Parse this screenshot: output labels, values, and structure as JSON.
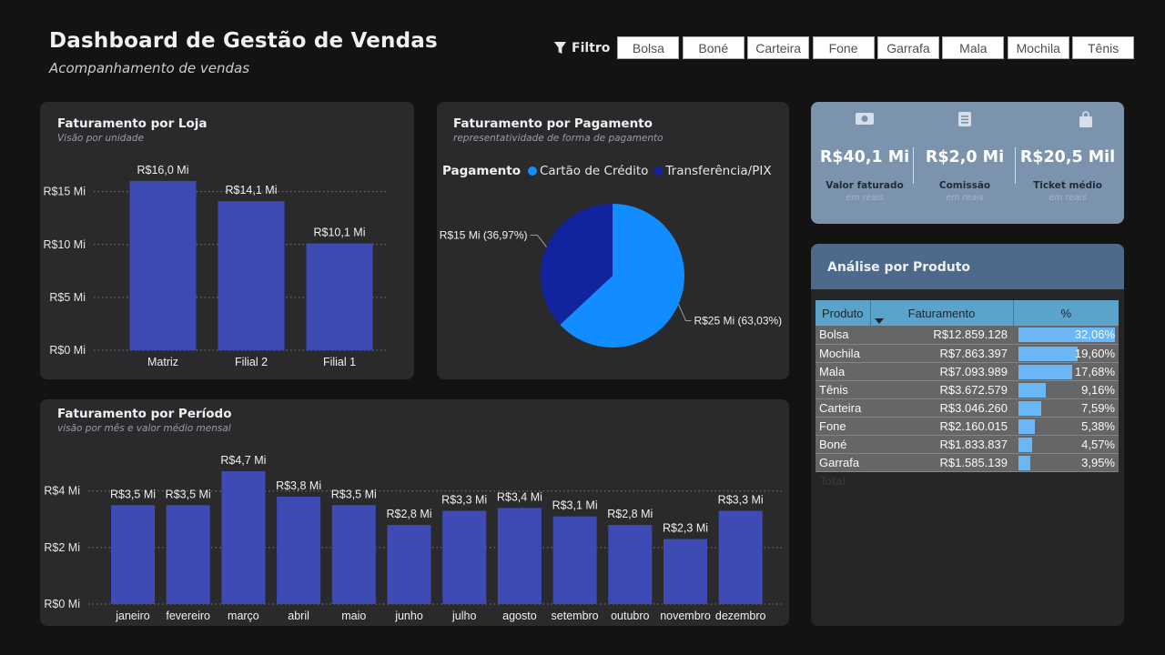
{
  "header": {
    "title": "Dashboard de Gestão de Vendas",
    "subtitle": "Acompanhamento de vendas"
  },
  "filter": {
    "label": "Filtro",
    "icon": "funnel-icon",
    "options": [
      "Bolsa",
      "Boné",
      "Carteira",
      "Fone",
      "Garrafa",
      "Mala",
      "Mochila",
      "Tênis"
    ]
  },
  "loja": {
    "title": "Faturamento por Loja",
    "subtitle": "Visão por unidade"
  },
  "pagamento": {
    "title": "Faturamento por Pagamento",
    "subtitle": "representatividade de forma de pagamento",
    "legend_title": "Pagamento"
  },
  "periodo": {
    "title": "Faturamento por Período",
    "subtitle": "visão por mês e valor médio mensal"
  },
  "kpis": [
    {
      "value": "R$40,1 Mi",
      "label": "Valor faturado",
      "unit": "em reais",
      "icon": "money-icon"
    },
    {
      "value": "R$2,0 Mi",
      "label": "Comissão",
      "unit": "em reais",
      "icon": "document-icon"
    },
    {
      "value": "R$20,5 Mil",
      "label": "Ticket médio",
      "unit": "em reais",
      "icon": "shopping-bag-icon"
    }
  ],
  "produto": {
    "title": "Análise por Produto",
    "columns": [
      "Produto",
      "Faturamento",
      "%"
    ],
    "rows": [
      {
        "produto": "Bolsa",
        "faturamento": "R$12.859.128",
        "pct_label": "32,06%",
        "pct": 32.06
      },
      {
        "produto": "Mochila",
        "faturamento": "R$7.863.397",
        "pct_label": "19,60%",
        "pct": 19.6
      },
      {
        "produto": "Mala",
        "faturamento": "R$7.093.989",
        "pct_label": "17,68%",
        "pct": 17.68
      },
      {
        "produto": "Tênis",
        "faturamento": "R$3.672.579",
        "pct_label": "9,16%",
        "pct": 9.16
      },
      {
        "produto": "Carteira",
        "faturamento": "R$3.046.260",
        "pct_label": "7,59%",
        "pct": 7.59
      },
      {
        "produto": "Fone",
        "faturamento": "R$2.160.015",
        "pct_label": "5,38%",
        "pct": 5.38
      },
      {
        "produto": "Boné",
        "faturamento": "R$1.833.837",
        "pct_label": "4,57%",
        "pct": 4.57
      },
      {
        "produto": "Garrafa",
        "faturamento": "R$1.585.139",
        "pct_label": "3,95%",
        "pct": 3.95
      }
    ],
    "total_label": "Total"
  },
  "chart_data": [
    {
      "type": "bar",
      "categories": [
        "Matriz",
        "Filial 2",
        "Filial 1"
      ],
      "values": [
        16.0,
        14.1,
        10.1
      ],
      "value_labels": [
        "R$16,0 Mi",
        "R$14,1 Mi",
        "R$10,1 Mi"
      ],
      "yticks": [
        0,
        5,
        15,
        10
      ],
      "ytick_labels": [
        "R$0 Mi",
        "R$5 Mi",
        "R$15 Mi",
        "R$10 Mi"
      ],
      "ylim": [
        0,
        16
      ],
      "grid": true,
      "color": "#3f4bb5"
    },
    {
      "type": "pie",
      "categories": [
        "Cartão de Crédito",
        "Transferência/PIX"
      ],
      "values": [
        63.03,
        36.97
      ],
      "value_labels": [
        "R$25 Mi (63,03%)",
        "R$15 Mi (36,97%)"
      ],
      "colors": [
        "#118dff",
        "#12239e"
      ],
      "legend": "top-left"
    },
    {
      "type": "bar",
      "categories": [
        "janeiro",
        "fevereiro",
        "março",
        "abril",
        "maio",
        "junho",
        "julho",
        "agosto",
        "setembro",
        "outubro",
        "novembro",
        "dezembro"
      ],
      "values": [
        3.5,
        3.5,
        4.7,
        3.8,
        3.5,
        2.8,
        3.3,
        3.4,
        3.1,
        2.8,
        2.3,
        3.3
      ],
      "value_labels": [
        "R$3,5 Mi",
        "R$3,5 Mi",
        "R$4,7 Mi",
        "R$3,8 Mi",
        "R$3,5 Mi",
        "R$2,8 Mi",
        "R$3,3 Mi",
        "R$3,4 Mi",
        "R$3,1 Mi",
        "R$2,8 Mi",
        "R$2,3 Mi",
        "R$3,3 Mi"
      ],
      "yticks": [
        0,
        2,
        4
      ],
      "ytick_labels": [
        "R$0 Mi",
        "R$2 Mi",
        "R$4 Mi"
      ],
      "ylim": [
        0,
        4.7
      ],
      "grid": true,
      "color": "#3f4bb5"
    }
  ]
}
